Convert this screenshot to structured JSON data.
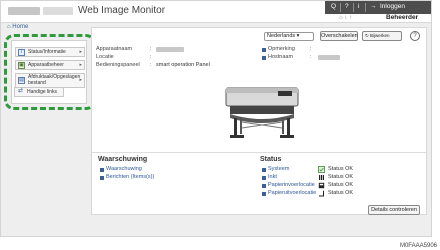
{
  "header": {
    "app_title": "Web Image Monitor",
    "topbar": {
      "search_symbol": "Q",
      "help_symbol": "?",
      "info_symbol": "i",
      "login_label": "Inloggen",
      "user_icons": "⌂ ↓ ↑",
      "user_role": "Beheerder"
    }
  },
  "breadcrumb": "⌂ Home",
  "sidebar": {
    "items": [
      {
        "label": "Status/Informatie",
        "icon": "info-icon"
      },
      {
        "label": "Apparaatbeheer",
        "icon": "device-icon"
      },
      {
        "label_line1": "Afdruktaak/Opgeslagen",
        "label_line2": "bestand",
        "icon": "print-job-icon"
      },
      {
        "label": "Handige links",
        "icon": "link-icon"
      }
    ],
    "arrow": "▸"
  },
  "toolbar": {
    "language_selected": "Nederlands ▾",
    "refresh_label": "Overschakelen",
    "update_label": "Bijwerken",
    "help_label": "?"
  },
  "device_info": {
    "apparaatnaam_label": "Apparaatnaam",
    "locatie_label": "Locatie",
    "bedieningspaneel_label": "Bedieningspaneel",
    "bedieningspaneel_value": "smart operation Panel",
    "colon": ":",
    "opmerking_label": "Opmerking",
    "hostnaam_label": "Hostnaam"
  },
  "warning": {
    "title": "Waarschuwing",
    "items": [
      "Waarschuwing",
      "Berichten (Items(s))"
    ]
  },
  "status": {
    "title": "Status",
    "rows": [
      {
        "label": "Systeem",
        "value": "Status OK",
        "icon": "system-icon"
      },
      {
        "label": "Inkt",
        "value": "Status OK",
        "icon": "ink-icon"
      },
      {
        "label": "Papierinvoerlocatie",
        "value": "Status OK",
        "icon": "paper-input-icon"
      },
      {
        "label": "Papieruitvoerlocatie",
        "value": "Status OK",
        "icon": "paper-output-icon"
      }
    ],
    "details_button": "Details controleren"
  },
  "footer_code": "M0FAAA5906"
}
